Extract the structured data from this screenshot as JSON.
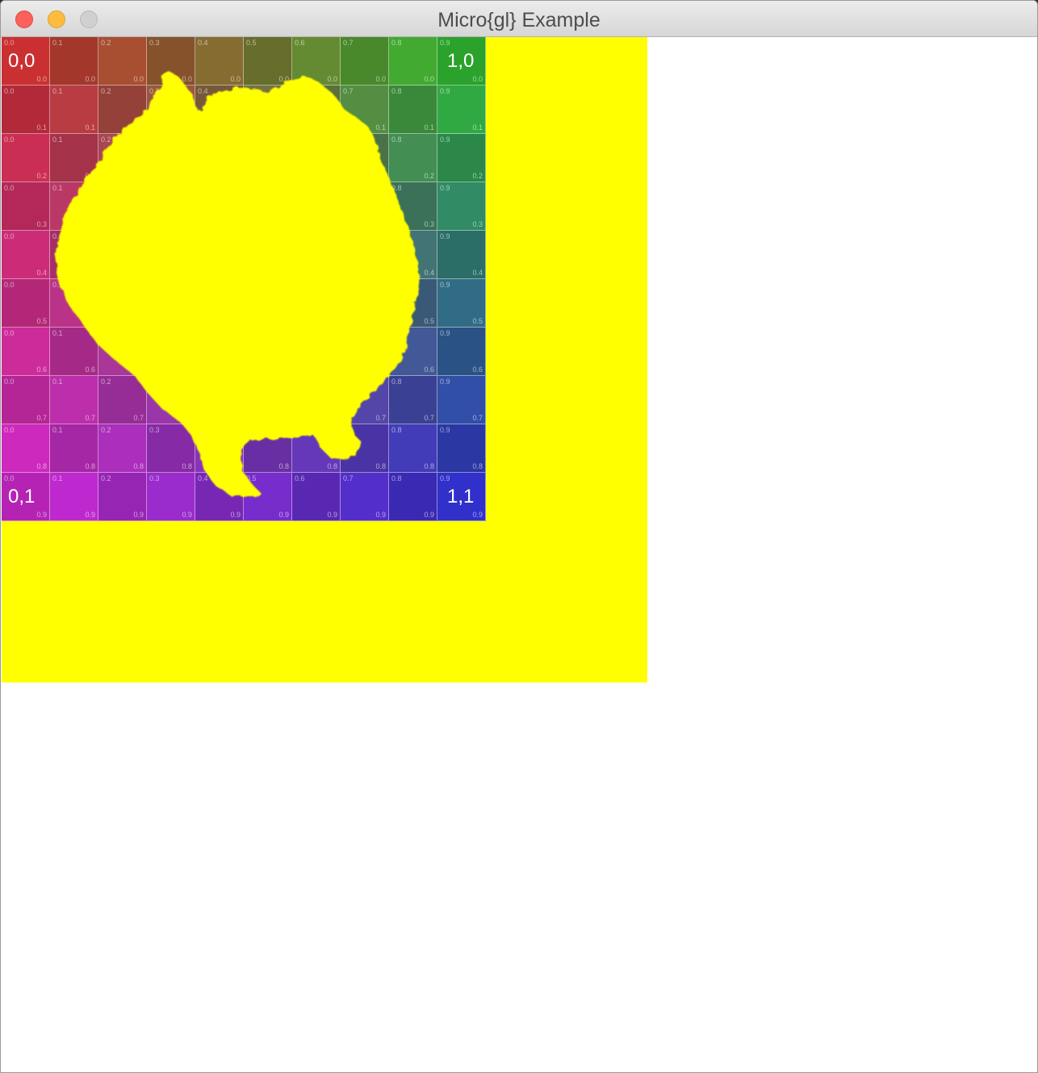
{
  "window": {
    "title": "Micro{gl} Example"
  },
  "canvas": {
    "background_color": "#ffff00",
    "texture": {
      "grid_size": 10,
      "corner_labels": {
        "top_left": "0,0",
        "top_right": "1,0",
        "bottom_left": "0,1",
        "bottom_right": "1,1"
      },
      "tick_values": [
        "0.0",
        "0.1",
        "0.2",
        "0.3",
        "0.4",
        "0.5",
        "0.6",
        "0.7",
        "0.8",
        "0.9"
      ]
    },
    "mask_color": "#ffff00"
  },
  "colors": {
    "close": "#fc605b",
    "minimize": "#fdbc40",
    "maximize": "#d0d0d0"
  }
}
